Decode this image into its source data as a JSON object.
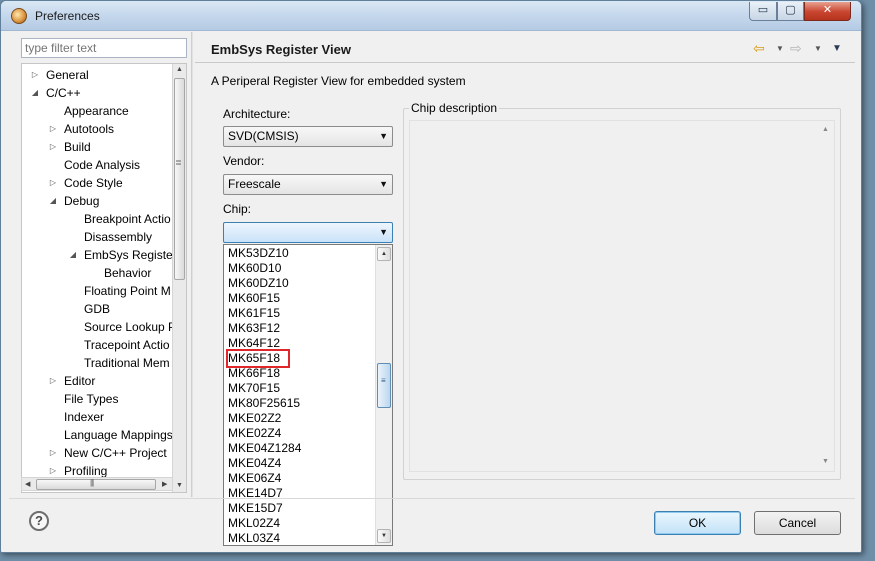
{
  "window": {
    "title": "Preferences",
    "minimize": "▭",
    "maximize": "▢",
    "close": "✕"
  },
  "left": {
    "filter_placeholder": "type filter text",
    "tree": [
      {
        "label": "General",
        "level": 0,
        "toggle": "▷"
      },
      {
        "label": "C/C++",
        "level": 0,
        "toggle": "◢"
      },
      {
        "label": "Appearance",
        "level": 1,
        "toggle": ""
      },
      {
        "label": "Autotools",
        "level": 1,
        "toggle": "▷"
      },
      {
        "label": "Build",
        "level": 1,
        "toggle": "▷"
      },
      {
        "label": "Code Analysis",
        "level": 1,
        "toggle": ""
      },
      {
        "label": "Code Style",
        "level": 1,
        "toggle": "▷"
      },
      {
        "label": "Debug",
        "level": 1,
        "toggle": "◢"
      },
      {
        "label": "Breakpoint Actio",
        "level": 2,
        "toggle": ""
      },
      {
        "label": "Disassembly",
        "level": 2,
        "toggle": ""
      },
      {
        "label": "EmbSys Register",
        "level": 2,
        "toggle": "◢"
      },
      {
        "label": "Behavior",
        "level": 3,
        "toggle": ""
      },
      {
        "label": "Floating Point M",
        "level": 2,
        "toggle": ""
      },
      {
        "label": "GDB",
        "level": 2,
        "toggle": ""
      },
      {
        "label": "Source Lookup P",
        "level": 2,
        "toggle": ""
      },
      {
        "label": "Tracepoint Actio",
        "level": 2,
        "toggle": ""
      },
      {
        "label": "Traditional Mem",
        "level": 2,
        "toggle": ""
      },
      {
        "label": "Editor",
        "level": 1,
        "toggle": "▷"
      },
      {
        "label": "File Types",
        "level": 1,
        "toggle": ""
      },
      {
        "label": "Indexer",
        "level": 1,
        "toggle": ""
      },
      {
        "label": "Language Mappings",
        "level": 1,
        "toggle": ""
      },
      {
        "label": "New C/C++ Project",
        "level": 1,
        "toggle": "▷"
      },
      {
        "label": "Profiling",
        "level": 1,
        "toggle": "▷"
      }
    ]
  },
  "page": {
    "title": "EmbSys Register View",
    "description": "A Periperal Register View for embedded system",
    "architecture_label": "Architecture:",
    "architecture_value": "SVD(CMSIS)",
    "vendor_label": "Vendor:",
    "vendor_value": "Freescale",
    "chip_label": "Chip:",
    "chip_value": "",
    "chip_description_label": "Chip description",
    "chip_list": [
      "MK53DZ10",
      "MK60D10",
      "MK60DZ10",
      "MK60F15",
      "MK61F15",
      "MK63F12",
      "MK64F12",
      "MK65F18",
      "MK66F18",
      "MK70F15",
      "MK80F25615",
      "MKE02Z2",
      "MKE02Z4",
      "MKE04Z1284",
      "MKE04Z4",
      "MKE06Z4",
      "MKE14D7",
      "MKE15D7",
      "MKL02Z4",
      "MKL03Z4"
    ],
    "highlighted_chip": "MK65F18",
    "highlight_color": "#e0262b"
  },
  "buttons": {
    "help": "?",
    "ok": "OK",
    "cancel": "Cancel"
  }
}
